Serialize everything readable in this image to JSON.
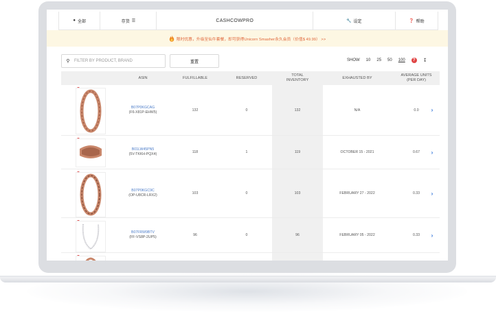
{
  "nav": {
    "all_label": "全部",
    "inventory_label": "存货",
    "brand": "CASHCOWPRO",
    "settings_label": "设定",
    "help_label": "帮助"
  },
  "banner": {
    "text": "限时优惠，升级至仙牛套餐，即可获得Unicorn Smasher永久会员（价值$ 49.99） >>"
  },
  "toolbar": {
    "search_placeholder": "FILTER BY PRODUCT, BRAND",
    "reset_label": "重置",
    "show_label": "SHOW",
    "show_options": [
      "10",
      "25",
      "50",
      "100"
    ],
    "show_selected": "100"
  },
  "table": {
    "headers": {
      "asin": "ASIN",
      "fulfillable": "FULFILLABLE",
      "reserved": "RESERVED",
      "total_1": "TOTAL",
      "total_2": "INVENTORY",
      "exhausted": "EXHAUSTED BY",
      "avg_1": "AVERAGE UNITS",
      "avg_2": "(PER DAY)"
    },
    "rows": [
      {
        "asin": "B07P0KGCAG",
        "sku": "(F6-X81P-EHW5)",
        "fulfillable": "132",
        "reserved": "0",
        "total": "132",
        "exhausted": "N/A",
        "avg": "0.0"
      },
      {
        "asin": "B01LW45PN5",
        "sku": "(5V-TKKH-PQX4)",
        "fulfillable": "118",
        "reserved": "1",
        "total": "119",
        "exhausted": "OCTOBER 15 - 2021",
        "avg": "0.67"
      },
      {
        "asin": "B07P0KGC9C",
        "sku": "(OP-U8CR-LRX2)",
        "fulfillable": "103",
        "reserved": "0",
        "total": "103",
        "exhausted": "FEBRUARY 27 - 2022",
        "avg": "0.33"
      },
      {
        "asin": "B07FRW9BTV",
        "sku": "(FF-VS8P-2UP5)",
        "fulfillable": "96",
        "reserved": "0",
        "total": "96",
        "exhausted": "FEBRUARY 05 - 2022",
        "avg": "0.33"
      }
    ]
  },
  "colors": {
    "banner_bg": "#fdf7e3",
    "banner_text": "#e0673a",
    "link": "#4a7bc8",
    "help": "#e04545",
    "copper": "#c9876b"
  }
}
